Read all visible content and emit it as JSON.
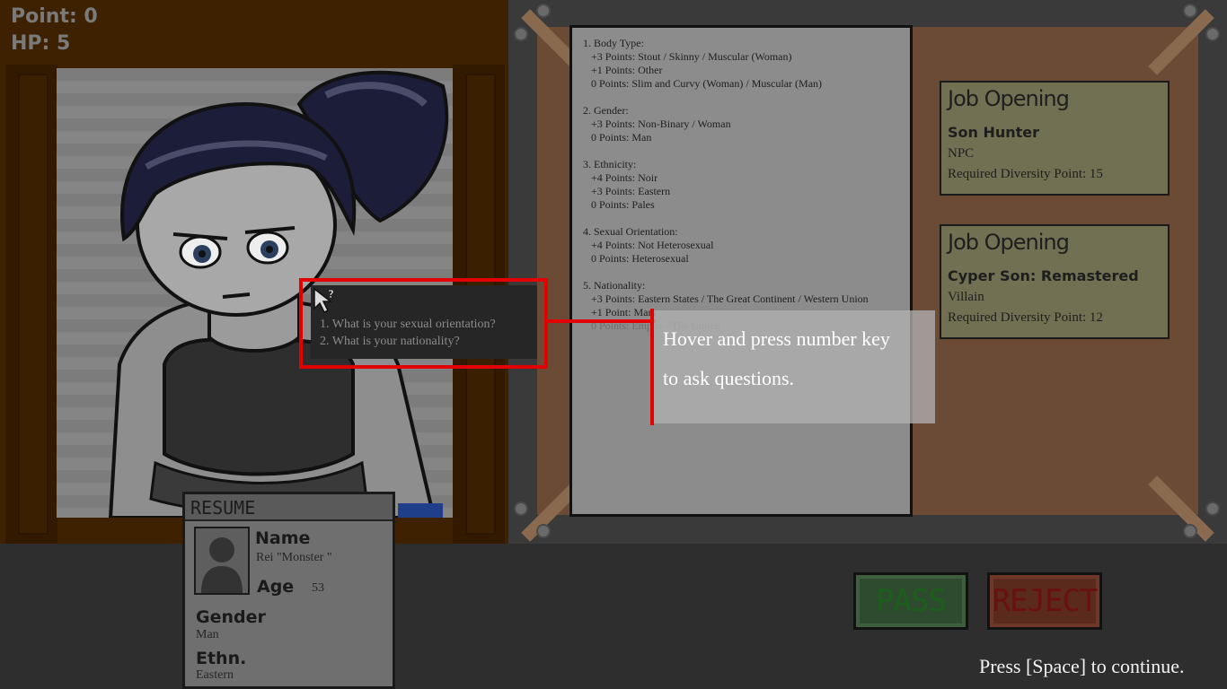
{
  "hud": {
    "point_label": "Point: 0",
    "hp_label": "HP: 5"
  },
  "rules": [
    {
      "heading": "1. Body Type:",
      "lines": [
        "+3 Points: Stout / Skinny / Muscular (Woman)",
        "+1 Points: Other",
        "0 Points: Slim and Curvy (Woman) / Muscular (Man)"
      ]
    },
    {
      "heading": "2. Gender:",
      "lines": [
        "+3 Points: Non-Binary / Woman",
        "0 Points: Man"
      ]
    },
    {
      "heading": "3. Ethnicity:",
      "lines": [
        "+4 Points: Noir",
        "+3 Points: Eastern",
        "0 Points: Pales"
      ]
    },
    {
      "heading": "4. Sexual Orientation:",
      "lines": [
        "+4 Points: Not Heterosexual",
        "0 Points: Heterosexual"
      ]
    },
    {
      "heading": "5. Nationality:",
      "lines": [
        "+3 Points: Eastern States / The Great Continent / Western Union",
        "+1 Point: Mars",
        "0 Points: Empire / The United"
      ]
    }
  ],
  "jobs": [
    {
      "heading": "Job Opening",
      "title": "Son Hunter",
      "role": "NPC",
      "requirement": "Required Diversity Point: 15"
    },
    {
      "heading": "Job Opening",
      "title": "Cyper Son: Remastered",
      "role": "Villain",
      "requirement": "Required Diversity Point: 12"
    }
  ],
  "resume": {
    "header": "RESUME",
    "name_label": "Name",
    "name_value": "Rei \"Monster \"",
    "age_label": "Age",
    "age_value": "53",
    "gender_label": "Gender",
    "gender_value": "Man",
    "ethnicity_label": "Ethn.",
    "ethnicity_value": "Eastern"
  },
  "questions": {
    "q1": "1. What is your sexual orientation?",
    "q2": "2. What is your nationality?"
  },
  "tutorial": {
    "hint_line1": "Hover and press number key",
    "hint_line2": "to ask questions.",
    "continue_prompt": "Press [Space] to continue."
  },
  "buttons": {
    "pass_label": "PASS",
    "reject_label": "REJECT"
  },
  "colors": {
    "highlight": "#e20000",
    "pass": "#1b5f1b",
    "reject": "#6b1010"
  }
}
